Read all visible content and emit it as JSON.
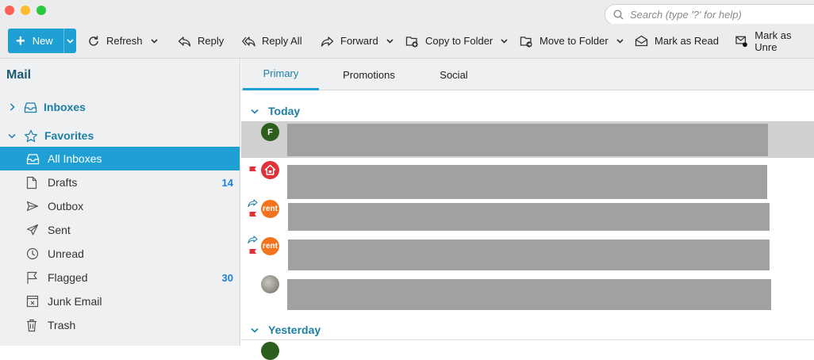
{
  "search": {
    "placeholder": "Search (type '?' for help)"
  },
  "toolbar": {
    "new_label": "New",
    "refresh_label": "Refresh",
    "reply_label": "Reply",
    "reply_all_label": "Reply All",
    "forward_label": "Forward",
    "copy_label": "Copy to Folder",
    "move_label": "Move to Folder",
    "mark_read_label": "Mark as Read",
    "mark_unread_label": "Mark as Unre"
  },
  "sidebar": {
    "title": "Mail",
    "inboxes_label": "Inboxes",
    "favorites_label": "Favorites",
    "items": [
      {
        "label": "All Inboxes",
        "icon": "inbox-icon",
        "count": ""
      },
      {
        "label": "Drafts",
        "icon": "draft-icon",
        "count": "14"
      },
      {
        "label": "Outbox",
        "icon": "outbox-icon",
        "count": ""
      },
      {
        "label": "Sent",
        "icon": "sent-icon",
        "count": ""
      },
      {
        "label": "Unread",
        "icon": "clock-icon",
        "count": ""
      },
      {
        "label": "Flagged",
        "icon": "flag-icon",
        "count": "30"
      },
      {
        "label": "Junk Email",
        "icon": "junk-icon",
        "count": ""
      },
      {
        "label": "Trash",
        "icon": "trash-icon",
        "count": ""
      }
    ]
  },
  "tabs": [
    {
      "label": "Primary",
      "active": true
    },
    {
      "label": "Promotions",
      "active": false
    },
    {
      "label": "Social",
      "active": false
    }
  ],
  "sections": {
    "today": "Today",
    "yesterday": "Yesterday"
  },
  "messages": [
    {
      "avatar_text": "F",
      "avatar_color": "#2e5e1e",
      "flagged": false,
      "forwarded": false
    },
    {
      "avatar_text": "",
      "avatar_color": "#e0313a",
      "flagged": true,
      "forwarded": false
    },
    {
      "avatar_text": "rent",
      "avatar_color": "#f4731e",
      "flagged": true,
      "forwarded": true
    },
    {
      "avatar_text": "rent",
      "avatar_color": "#f4731e",
      "flagged": true,
      "forwarded": true
    },
    {
      "avatar_text": "",
      "avatar_color": "#8a8a82",
      "flagged": false,
      "forwarded": false
    }
  ],
  "colors": {
    "accent": "#1ea0d4",
    "section_text": "#1b7fa6",
    "count_text": "#1b7fe0",
    "flag": "#e0313a"
  }
}
